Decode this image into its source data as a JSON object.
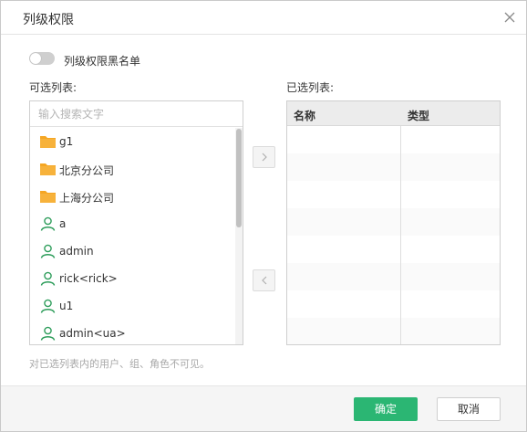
{
  "dialog": {
    "title": "列级权限",
    "close_icon": "close-icon"
  },
  "toggle": {
    "label": "列级权限黑名单",
    "state": "off"
  },
  "available": {
    "label": "可选列表:",
    "search_placeholder": "输入搜索文字",
    "items": [
      {
        "label": "g1",
        "icon": "folder-icon"
      },
      {
        "label": "北京分公司",
        "icon": "folder-icon"
      },
      {
        "label": "上海分公司",
        "icon": "folder-icon"
      },
      {
        "label": "a",
        "icon": "user-icon"
      },
      {
        "label": "admin",
        "icon": "user-icon"
      },
      {
        "label": "rick<rick>",
        "icon": "user-icon"
      },
      {
        "label": "u1",
        "icon": "user-icon"
      },
      {
        "label": "admin<ua>",
        "icon": "user-icon"
      }
    ]
  },
  "selected": {
    "label": "已选列表:",
    "columns": [
      "名称",
      "类型"
    ],
    "rows": []
  },
  "note": "对已选列表内的用户、组、角色不可见。",
  "footer": {
    "ok_label": "确定",
    "cancel_label": "取消"
  },
  "colors": {
    "folder": "#f5a623",
    "user": "#2e9d5b",
    "primary": "#2bb673"
  }
}
